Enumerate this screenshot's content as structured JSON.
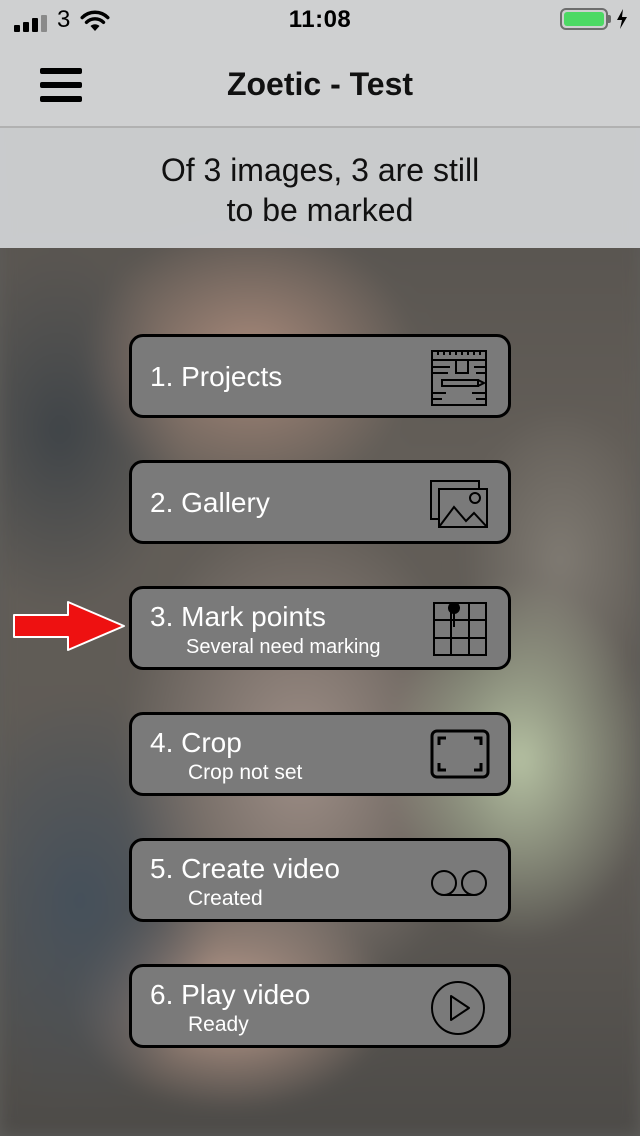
{
  "status_bar": {
    "carrier": "3",
    "time": "11:08",
    "battery_color": "#4cd964"
  },
  "nav": {
    "title": "Zoetic - Test",
    "menu_icon": "hamburger-menu-icon"
  },
  "info_banner": {
    "line1": "Of 3 images, 3 are still",
    "line2": "to be marked"
  },
  "menu_items": [
    {
      "label": "1. Projects",
      "subtitle": "",
      "icon": "blueprint-icon"
    },
    {
      "label": "2. Gallery",
      "subtitle": "",
      "icon": "gallery-icon"
    },
    {
      "label": "3. Mark points",
      "subtitle": "Several need marking",
      "icon": "grid-pin-icon"
    },
    {
      "label": "4. Crop",
      "subtitle": "Crop not set",
      "icon": "crop-frame-icon"
    },
    {
      "label": "5. Create video",
      "subtitle": "Created",
      "icon": "tape-icon"
    },
    {
      "label": "6. Play video",
      "subtitle": "Ready",
      "icon": "play-icon"
    }
  ],
  "annotation": {
    "arrow_color": "#ee1111",
    "points_to": "3. Mark points"
  }
}
